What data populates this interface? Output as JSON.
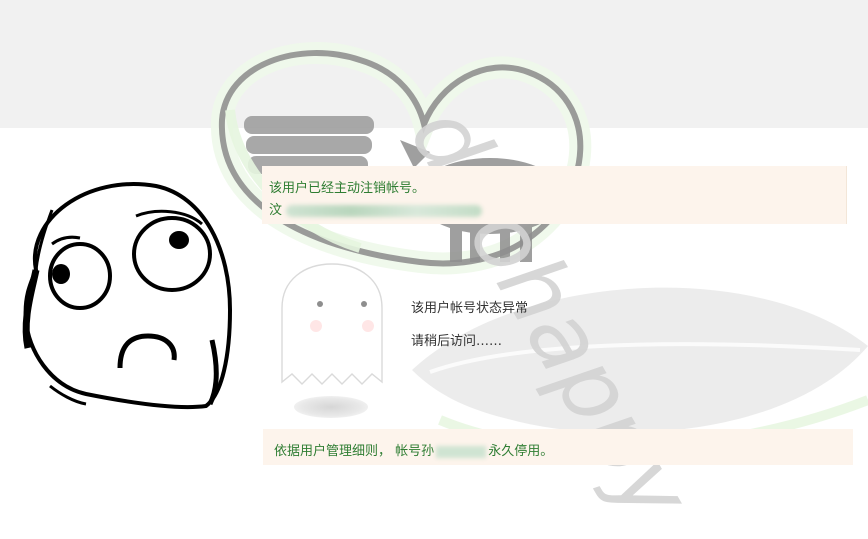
{
  "watermark": {
    "text": "duohappy"
  },
  "notice": {
    "account_cancelled": "该用户已经主动注销帐号。",
    "line2_prefix": "汶"
  },
  "status": {
    "title": "该用户帐号状态异常",
    "retry": "请稍后访问……"
  },
  "policy": {
    "prefix": "依据用户管理细则，",
    "account_label": "帐号",
    "account_partial": "孙",
    "suffix": "永久停用。"
  },
  "colors": {
    "notice_bg": "#fdf4ec",
    "notice_text": "#2e7d32",
    "top_band": "#f1f1f1"
  },
  "icons": {
    "ghost": "ghost-illustration",
    "face": "worried-rage-face",
    "watermark_logo": "heart-leaf-logo"
  }
}
